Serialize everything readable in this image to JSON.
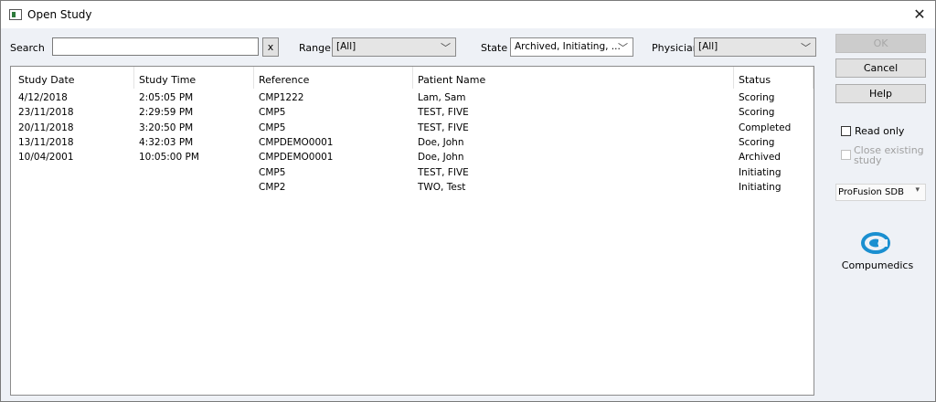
{
  "window": {
    "title": "Open Study",
    "icon": "window-app-icon",
    "close_icon": "close-icon"
  },
  "search": {
    "label": "Search",
    "value": "",
    "placeholder": "",
    "clear_label": "x"
  },
  "range": {
    "label": "Range",
    "value": "[All]"
  },
  "state": {
    "label": "State",
    "value": "Archived, Initiating, ..."
  },
  "physician": {
    "label": "Physician",
    "value": "[All]"
  },
  "table": {
    "columns": [
      "Study Date",
      "Study Time",
      "Reference",
      "Patient Name",
      "Status"
    ],
    "rows": [
      [
        "4/12/2018",
        "2:05:05 PM",
        "CMP1222",
        "Lam, Sam",
        "Scoring"
      ],
      [
        "23/11/2018",
        "2:29:59 PM",
        "CMP5",
        "TEST, FIVE",
        "Scoring"
      ],
      [
        "20/11/2018",
        "3:20:50 PM",
        "CMP5",
        "TEST, FIVE",
        "Completed"
      ],
      [
        "13/11/2018",
        "4:32:03 PM",
        "CMPDEMO0001",
        "Doe, John",
        "Scoring"
      ],
      [
        "10/04/2001",
        "10:05:00 PM",
        "CMPDEMO0001",
        "Doe, John",
        "Archived"
      ],
      [
        "",
        "",
        "CMP5",
        "TEST, FIVE",
        "Initiating"
      ],
      [
        "",
        "",
        "CMP2",
        "TWO, Test",
        "Initiating"
      ]
    ]
  },
  "buttons": {
    "ok": "OK",
    "cancel": "Cancel",
    "help": "Help"
  },
  "options": {
    "read_only": {
      "label": "Read only",
      "checked": false
    },
    "close_existing": {
      "label_line1": "Close existing",
      "label_line2": "study",
      "checked": false,
      "enabled": false
    }
  },
  "database": {
    "value": "ProFusion SDB"
  },
  "logo": {
    "name": "Compumedics",
    "icon": "compumedics-logo-icon",
    "color": "#1a8fd0"
  }
}
